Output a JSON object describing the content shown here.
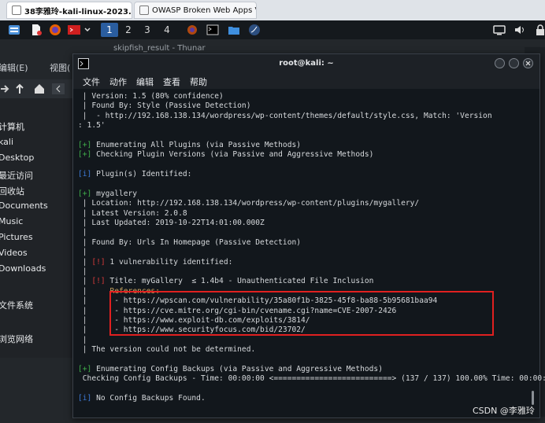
{
  "browser_tabs": [
    {
      "label": "38李雅玲-kali-linux-2023....",
      "close": "×",
      "active": true
    },
    {
      "label": "OWASP Broken Web Apps VM...",
      "close": "×",
      "active": false
    }
  ],
  "panel": {
    "workspaces": [
      "1",
      "2",
      "3",
      "4"
    ],
    "active_workspace": "1"
  },
  "file_manager": {
    "title": "skipfish_result - Thunar",
    "menu": [
      "编辑(E)",
      "视图("
    ],
    "sidebar": [
      "计算机",
      "kali",
      "Desktop",
      "最近访问",
      "回收站",
      "Documents",
      "Music",
      "Pictures",
      "Videos",
      "Downloads",
      "文件系统",
      "浏览网络"
    ]
  },
  "terminal": {
    "title": "root@kali: ~",
    "menu": [
      "文件",
      "动作",
      "编辑",
      "查看",
      "帮助"
    ],
    "lines": [
      [
        {
          "t": " | Version: 1.5 (80% confidence)",
          "c": ""
        }
      ],
      [
        {
          "t": " | Found By: Style (Passive Detection)",
          "c": ""
        }
      ],
      [
        {
          "t": " |  - http://192.168.138.134/wordpress/wp-content/themes/default/style.css, Match: 'Version",
          "c": ""
        }
      ],
      [
        {
          "t": ": 1.5'",
          "c": ""
        }
      ],
      [
        {
          "t": "",
          "c": ""
        }
      ],
      [
        {
          "t": "[+]",
          "c": "c-green"
        },
        {
          "t": " Enumerating All Plugins (via Passive Methods)",
          "c": ""
        }
      ],
      [
        {
          "t": "[+]",
          "c": "c-green"
        },
        {
          "t": " Checking Plugin Versions (via Passive and Aggressive Methods)",
          "c": ""
        }
      ],
      [
        {
          "t": "",
          "c": ""
        }
      ],
      [
        {
          "t": "[i]",
          "c": "c-blue"
        },
        {
          "t": " Plugin(s) Identified:",
          "c": ""
        }
      ],
      [
        {
          "t": "",
          "c": ""
        }
      ],
      [
        {
          "t": "[+]",
          "c": "c-green"
        },
        {
          "t": " mygallery",
          "c": ""
        }
      ],
      [
        {
          "t": " | Location: http://192.168.138.134/wordpress/wp-content/plugins/mygallery/",
          "c": ""
        }
      ],
      [
        {
          "t": " | Latest Version: 2.0.8",
          "c": ""
        }
      ],
      [
        {
          "t": " | Last Updated: 2019-10-22T14:01:00.000Z",
          "c": ""
        }
      ],
      [
        {
          "t": " |",
          "c": ""
        }
      ],
      [
        {
          "t": " | Found By: Urls In Homepage (Passive Detection)",
          "c": ""
        }
      ],
      [
        {
          "t": " |",
          "c": ""
        }
      ],
      [
        {
          "t": " | ",
          "c": ""
        },
        {
          "t": "[!]",
          "c": "c-red"
        },
        {
          "t": " 1 vulnerability identified:",
          "c": ""
        }
      ],
      [
        {
          "t": " |",
          "c": ""
        }
      ],
      [
        {
          "t": " | ",
          "c": ""
        },
        {
          "t": "[!]",
          "c": "c-red"
        },
        {
          "t": " Title: myGallery  ≤ 1.4b4 - Unauthenticated File Inclusion",
          "c": ""
        }
      ],
      [
        {
          "t": " |     ",
          "c": ""
        },
        {
          "t": "References:",
          "c": "c-refs"
        }
      ],
      [
        {
          "t": " |      - https://wpscan.com/vulnerability/35a80f1b-3825-45f8-ba88-5b95681baa94",
          "c": ""
        }
      ],
      [
        {
          "t": " |      - https://cve.mitre.org/cgi-bin/cvename.cgi?name=CVE-2007-2426",
          "c": ""
        }
      ],
      [
        {
          "t": " |      - https://www.exploit-db.com/exploits/3814/",
          "c": ""
        }
      ],
      [
        {
          "t": " |      - https://www.securityfocus.com/bid/23702/",
          "c": ""
        }
      ],
      [
        {
          "t": " |",
          "c": ""
        }
      ],
      [
        {
          "t": " | The version could not be determined.",
          "c": ""
        }
      ],
      [
        {
          "t": "",
          "c": ""
        }
      ],
      [
        {
          "t": "[+]",
          "c": "c-green"
        },
        {
          "t": " Enumerating Config Backups (via Passive and Aggressive Methods)",
          "c": ""
        }
      ],
      [
        {
          "t": " Checking Config Backups - Time: 00:00:00 <==========================> (137 / 137) 100.00% Time: 00:00:00",
          "c": ""
        }
      ],
      [
        {
          "t": "",
          "c": ""
        }
      ],
      [
        {
          "t": "[i]",
          "c": "c-blue"
        },
        {
          "t": " No Config Backups Found.",
          "c": ""
        }
      ]
    ]
  },
  "watermark": "CSDN @李雅玲"
}
